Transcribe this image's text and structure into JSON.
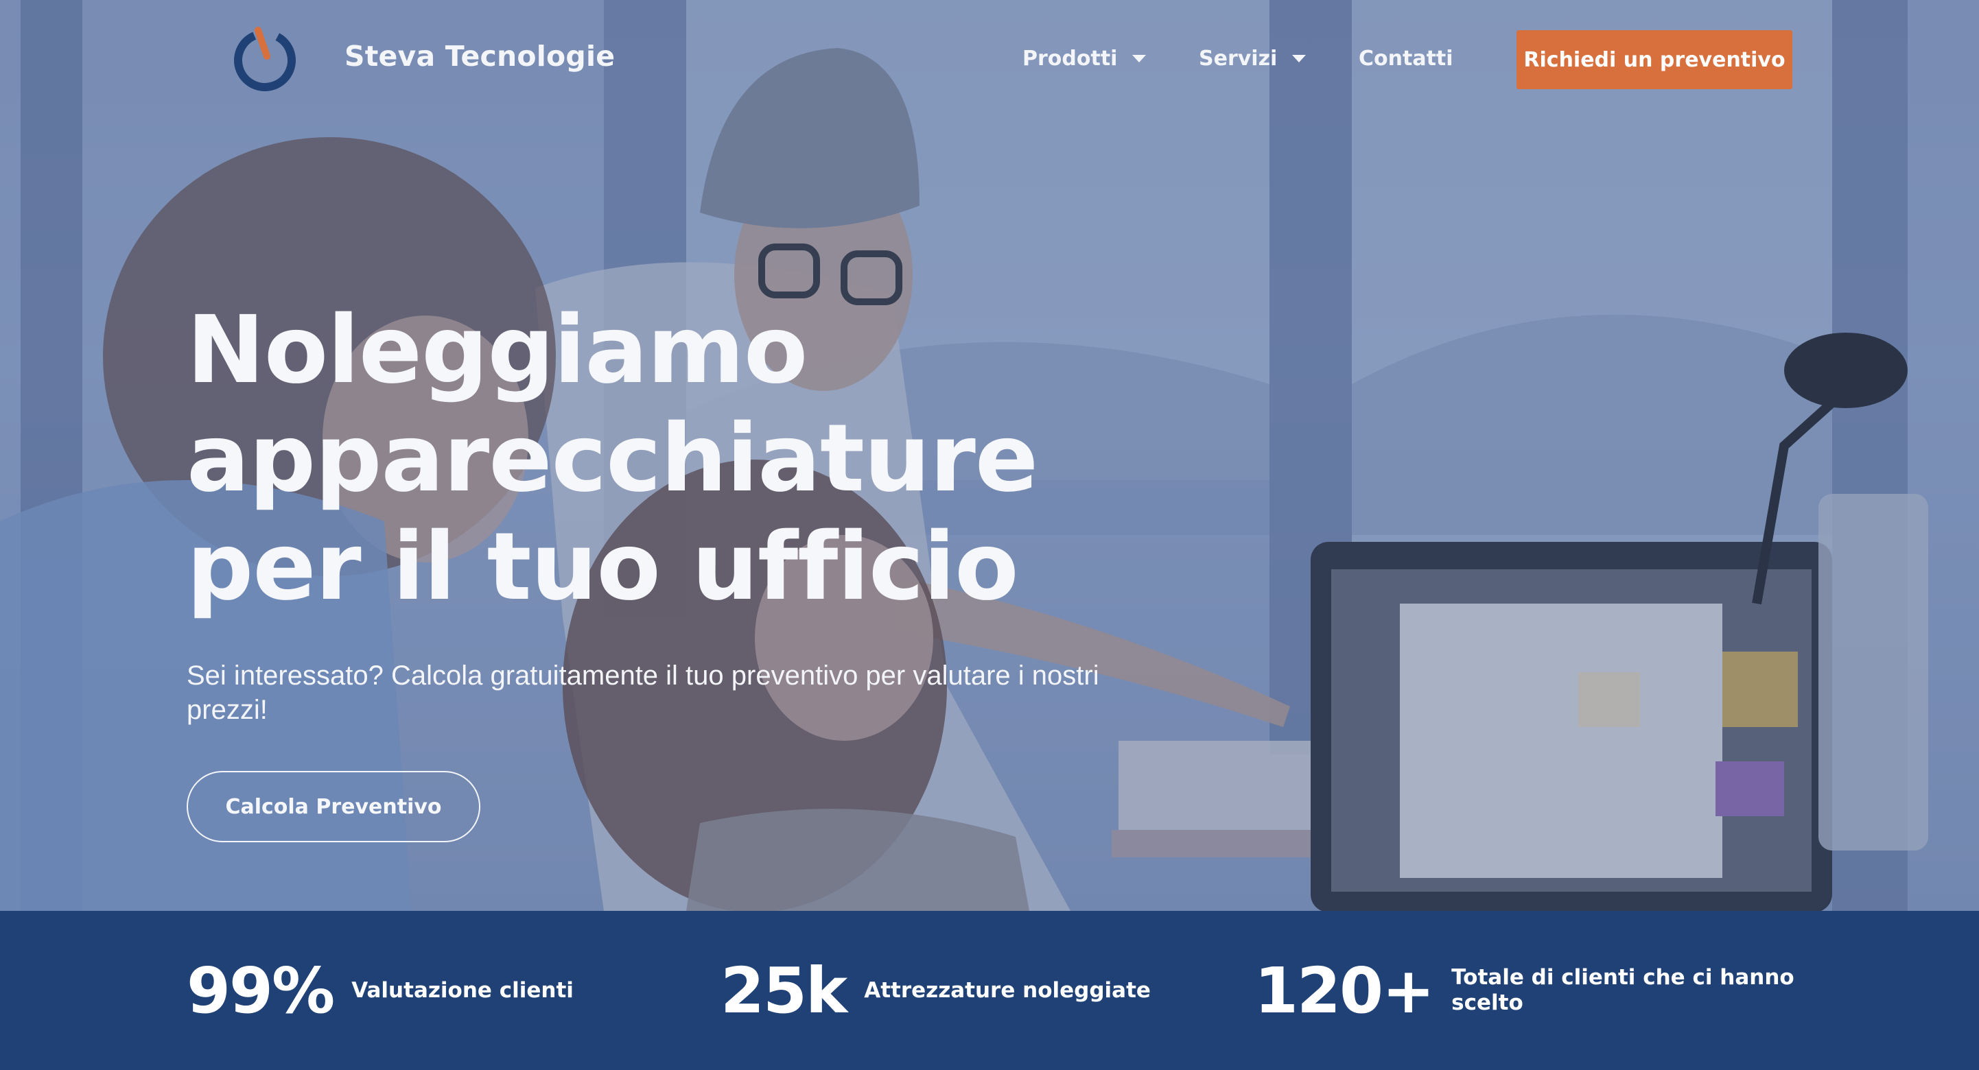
{
  "brand": {
    "name": "Steva Tecnologie",
    "logo_icon": "power-ring-logo",
    "logo_ring_color": "#1f4176",
    "logo_accent_color": "#d8703d"
  },
  "nav": {
    "items": [
      {
        "label": "Prodotti",
        "has_dropdown": true
      },
      {
        "label": "Servizi",
        "has_dropdown": true
      },
      {
        "label": "Contatti",
        "has_dropdown": false
      }
    ],
    "cta_label": "Richiedi un preventivo",
    "cta_color": "#d8703d"
  },
  "hero": {
    "headline": [
      "Noleggiamo",
      "apparecchiature",
      "per il tuo ufficio"
    ],
    "subtitle": "Sei interessato? Calcola gratuitamente il tuo preventivo per valutare i nostri prezzi!",
    "cta_label": "Calcola Preventivo",
    "background": "team-at-office-photo",
    "overlay_color": "#566ea0"
  },
  "stats": [
    {
      "value": "99%",
      "label": "Valutazione clienti"
    },
    {
      "value": "25k",
      "label": "Attrezzature noleggiate"
    },
    {
      "value": "120+",
      "label": "Totale di clienti che ci hanno scelto"
    }
  ],
  "stats_band_color": "#1f4176"
}
